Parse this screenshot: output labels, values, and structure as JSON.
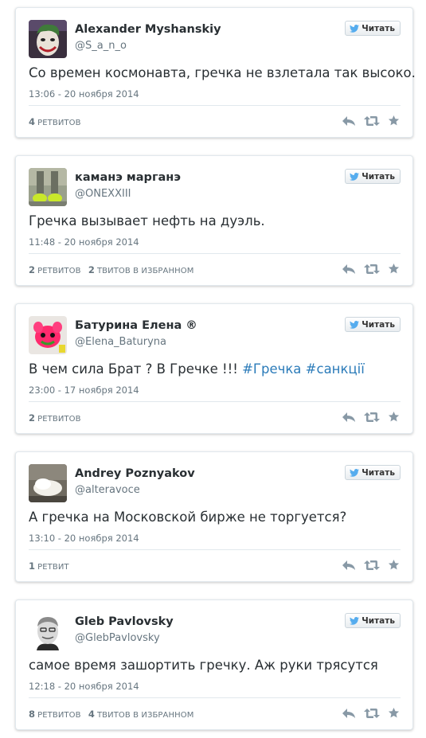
{
  "follow_label": "Читать",
  "tweets": [
    {
      "name": "Alexander Myshanskiy",
      "handle": "@S_a_n_o",
      "text": "Со времен космонавта, гречка не взлетала так высоко.",
      "hashtags": [],
      "time": "13:06 - 20 ноября 2014",
      "stats": [
        {
          "count": "4",
          "label": "ретвитов"
        }
      ],
      "avatar": "avatar-joker-face"
    },
    {
      "name": "каманэ марганэ",
      "handle": "@ONEXXIII",
      "text": "Гречка вызывает нефть на дуэль.",
      "hashtags": [],
      "time": "11:48 - 20 ноября 2014",
      "stats": [
        {
          "count": "2",
          "label": "ретвитов"
        },
        {
          "count": "2",
          "label": "твитов в избранном"
        }
      ],
      "avatar": "avatar-sneakers"
    },
    {
      "name": "Батурина Елена ®",
      "handle": "@Elena_Baturyna",
      "text": "В чем сила Брат ? В Гречке !!! ",
      "hashtags": [
        "#Гречка",
        "#санкції"
      ],
      "time": "23:00 - 17 ноября 2014",
      "stats": [
        {
          "count": "2",
          "label": "ретвитов"
        }
      ],
      "avatar": "avatar-pink-toy"
    },
    {
      "name": "Andrey Poznyakov",
      "handle": "@alteravoce",
      "text": "А гречка на Московской бирже не торгуется?",
      "hashtags": [],
      "time": "13:10 - 20 ноября 2014",
      "stats": [
        {
          "count": "1",
          "label": "ретвит"
        }
      ],
      "avatar": "avatar-white-object"
    },
    {
      "name": "Gleb Pavlovsky",
      "handle": "@GlebPavlovsky",
      "text": "самое время зашортить гречку. Аж руки трясутся",
      "hashtags": [],
      "time": "12:18 - 20 ноября 2014",
      "stats": [
        {
          "count": "8",
          "label": "ретвитов"
        },
        {
          "count": "4",
          "label": "твитов в избранном"
        }
      ],
      "avatar": "avatar-man-portrait"
    }
  ],
  "colors": {
    "hashtag": "#2b7bb9",
    "twitter_bird": "#55acee",
    "action_icon": "#8899a6",
    "muted_text": "#66757f"
  }
}
